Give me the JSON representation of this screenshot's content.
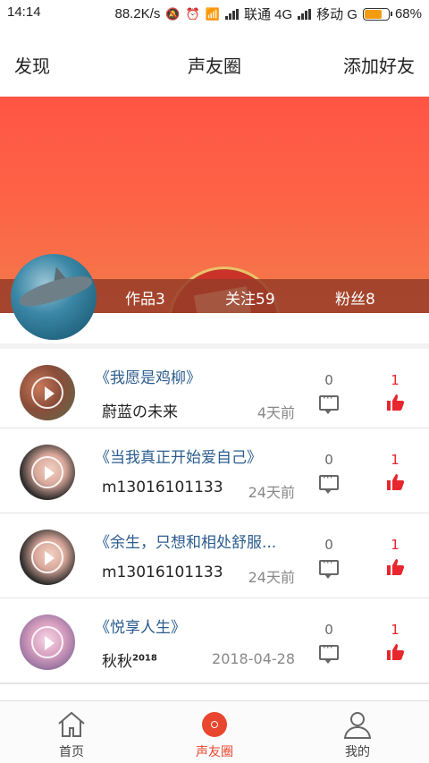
{
  "status_bar": {
    "time": "14:14",
    "speed": "88.2K/s",
    "carrier1": "联通 4G",
    "carrier2": "移动 G",
    "battery": "68%",
    "battery_level": 0.68
  },
  "header": {
    "left": "发现",
    "title": "声友圈",
    "right": "添加好友"
  },
  "profile": {
    "works": "作品3",
    "following": "关注59",
    "fans": "粉丝8"
  },
  "feed": [
    {
      "title": "《我愿是鸡柳》",
      "user": "蔚蓝の未来",
      "user_sup": "",
      "time": "4天前",
      "comments": "0",
      "likes": "1"
    },
    {
      "title": "《当我真正开始爱自己》",
      "user": "m13016101133",
      "user_sup": "",
      "time": "24天前",
      "comments": "0",
      "likes": "1"
    },
    {
      "title": "《余生，只想和相处舒服...",
      "user": "m13016101133",
      "user_sup": "",
      "time": "24天前",
      "comments": "0",
      "likes": "1"
    },
    {
      "title": "《悦享人生》",
      "user": "秋秋",
      "user_sup": "2018",
      "time": "2018-04-28",
      "comments": "0",
      "likes": "1"
    }
  ],
  "tabbar": {
    "home": "首页",
    "circle": "声友圈",
    "mine": "我的"
  },
  "colors": {
    "accent": "#e8462e",
    "like": "#e8262e",
    "title_link": "#2c5d8f"
  }
}
